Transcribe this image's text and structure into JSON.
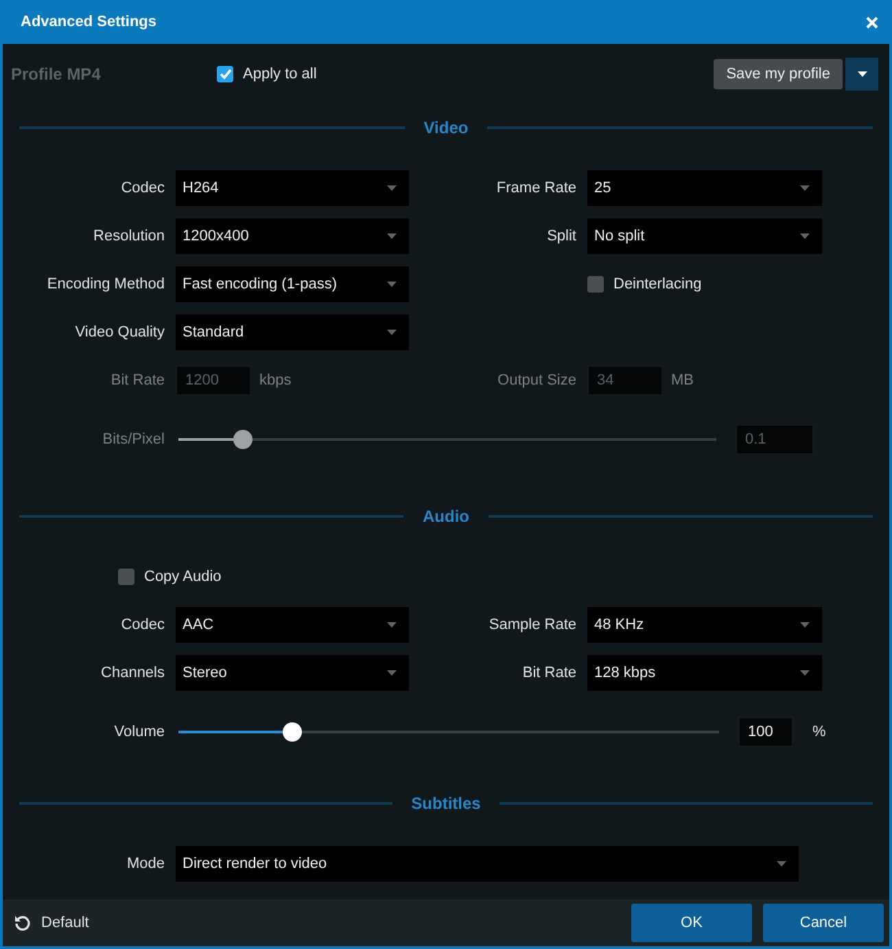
{
  "window": {
    "title": "Advanced Settings"
  },
  "profile": {
    "label": "Profile",
    "value": "MP4"
  },
  "apply_to_all": {
    "label": "Apply to all",
    "checked": true
  },
  "save_profile": {
    "label": "Save my profile"
  },
  "sections": [
    {
      "title": "Video",
      "rows": [
        {
          "left": {
            "kind": "select",
            "label": "Codec",
            "value": "H264"
          },
          "right": {
            "kind": "select",
            "label": "Frame Rate",
            "value": "25"
          }
        },
        {
          "left": {
            "kind": "select",
            "label": "Resolution",
            "value": "1200x400"
          },
          "right": {
            "kind": "select",
            "label": "Split",
            "value": "No split"
          }
        },
        {
          "left": {
            "kind": "select",
            "label": "Encoding Method",
            "value": "Fast encoding (1-pass)"
          },
          "right": {
            "kind": "checkbox",
            "label": "Deinterlacing",
            "checked": false
          }
        },
        {
          "left": {
            "kind": "select",
            "label": "Video Quality",
            "value": "Standard"
          }
        },
        {
          "left": {
            "kind": "input",
            "label": "Bit Rate",
            "value": "1200",
            "unit": "kbps",
            "disabled": true
          },
          "right": {
            "kind": "input",
            "label": "Output Size",
            "value": "34",
            "unit": "MB",
            "disabled": true
          }
        },
        {
          "full": {
            "kind": "slider",
            "label": "Bits/Pixel",
            "level": 0.12,
            "value": "0.1",
            "disabled": true
          }
        }
      ]
    },
    {
      "title": "Audio",
      "rows": [
        {
          "left": {
            "kind": "checkbox",
            "label": "Copy Audio",
            "checked": false
          }
        },
        {
          "left": {
            "kind": "select",
            "label": "Codec",
            "value": "AAC"
          },
          "right": {
            "kind": "select",
            "label": "Sample Rate",
            "value": "48 KHz"
          }
        },
        {
          "left": {
            "kind": "select",
            "label": "Channels",
            "value": "Stereo"
          },
          "right": {
            "kind": "select",
            "label": "Bit Rate",
            "value": "128 kbps"
          }
        },
        {
          "full": {
            "kind": "slider",
            "label": "Volume",
            "level": 0.21,
            "value": "100",
            "unit": "%",
            "disabled": false
          }
        }
      ]
    },
    {
      "title": "Subtitles",
      "rows": [
        {
          "full": {
            "kind": "select",
            "label": "Mode",
            "value": "Direct render to video"
          }
        }
      ]
    }
  ],
  "footer": {
    "default": "Default",
    "ok": "OK",
    "cancel": "Cancel"
  }
}
